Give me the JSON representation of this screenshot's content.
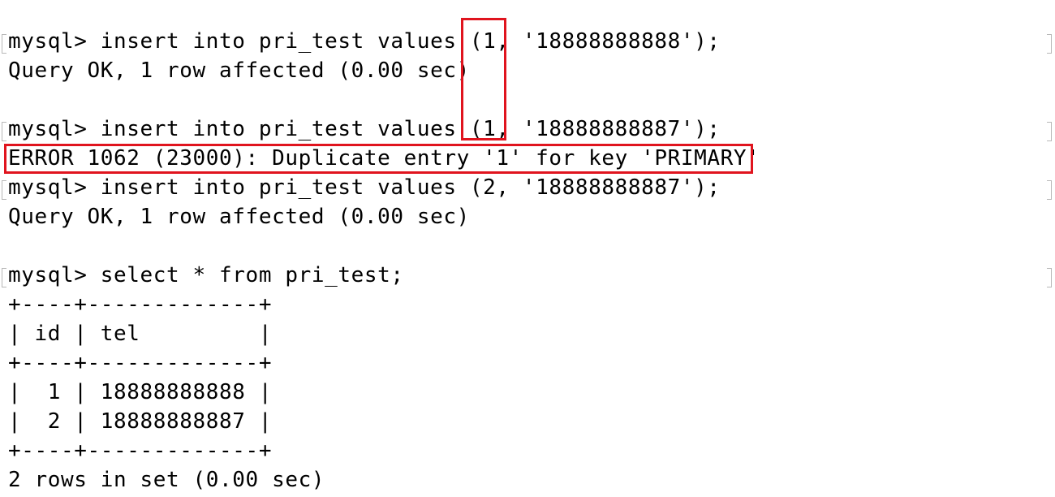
{
  "terminal": {
    "lines": [
      "mysql> insert into pri_test values (1, '18888888888');",
      "Query OK, 1 row affected (0.00 sec)",
      "",
      "mysql> insert into pri_test values (1, '18888888887');",
      "ERROR 1062 (23000): Duplicate entry '1' for key 'PRIMARY'",
      "mysql> insert into pri_test values (2, '18888888887');",
      "Query OK, 1 row affected (0.00 sec)",
      "",
      "mysql> select * from pri_test;",
      "+----+-------------+",
      "| id | tel         |",
      "+----+-------------+",
      "|  1 | 18888888888 |",
      "|  2 | 18888888887 |",
      "+----+-------------+",
      "2 rows in set (0.00 sec)"
    ]
  },
  "annotations": {
    "highlight_color": "#e0141e"
  }
}
